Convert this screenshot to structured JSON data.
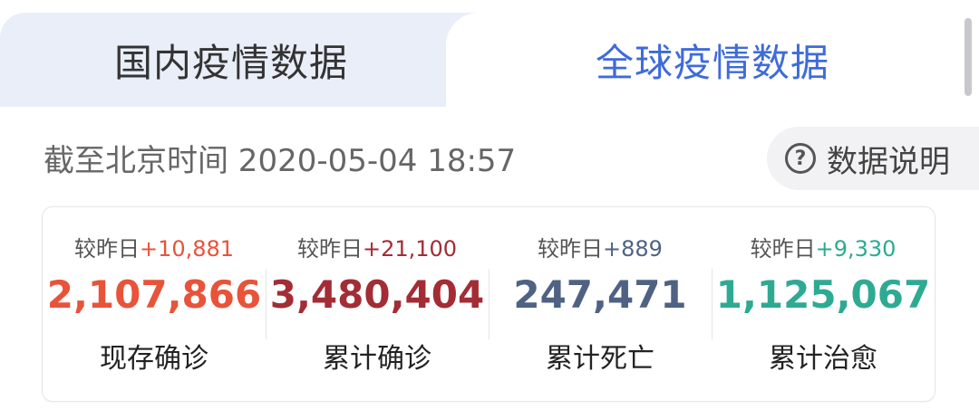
{
  "tabs": {
    "domestic_label": "国内疫情数据",
    "global_label": "全球疫情数据"
  },
  "timestamp": "截至北京时间 2020-05-04 18:57",
  "help": {
    "icon": "question-circle-icon",
    "label": "数据说明"
  },
  "colors": {
    "active_tab": "#3f6bd9",
    "inactive_tab_bg": "#e9eef9",
    "current_confirmed": "#e8533a",
    "cumulative_confirmed": "#a32c35",
    "deaths": "#4f6283",
    "recovered": "#2eaa93"
  },
  "stats": [
    {
      "delta_prefix": "较昨日",
      "delta": "+10,881",
      "value": "2,107,866",
      "label": "现存确诊",
      "color": "#e8533a"
    },
    {
      "delta_prefix": "较昨日",
      "delta": "+21,100",
      "value": "3,480,404",
      "label": "累计确诊",
      "color": "#a32c35"
    },
    {
      "delta_prefix": "较昨日",
      "delta": "+889",
      "value": "247,471",
      "label": "累计死亡",
      "color": "#4f6283"
    },
    {
      "delta_prefix": "较昨日",
      "delta": "+9,330",
      "value": "1,125,067",
      "label": "累计治愈",
      "color": "#2eaa93"
    }
  ]
}
